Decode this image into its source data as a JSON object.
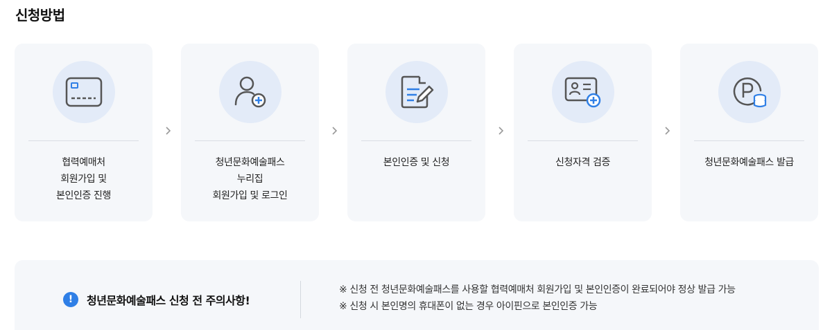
{
  "section_title": "신청방법",
  "steps": [
    {
      "icon": "credit-card-icon",
      "lines": [
        "협력예매처",
        "회원가입 및",
        "본인인증 진행"
      ]
    },
    {
      "icon": "user-add-icon",
      "lines": [
        "청년문화예술패스",
        "누리집",
        "회원가입 및 로그인"
      ]
    },
    {
      "icon": "document-edit-icon",
      "lines": [
        "본인인증 및 신청"
      ]
    },
    {
      "icon": "id-card-add-icon",
      "lines": [
        "신청자격 검증"
      ]
    },
    {
      "icon": "point-coin-icon",
      "lines": [
        "청년문화예술패스 발급"
      ]
    }
  ],
  "notice": {
    "icon_text": "!",
    "title": "청년문화예술패스 신청 전 주의사항!",
    "notes": [
      "※ 신청 전 청년문화예술패스를 사용할 협력예매처 회원가입 및 본인인증이 완료되어야 정상 발급 가능",
      "※ 신청 시 본인명의 휴대폰이 없는 경우 아이핀으로 본인인증 가능"
    ]
  },
  "colors": {
    "card_bg": "#f5f7fa",
    "icon_circle": "#e3ebf8",
    "icon_stroke": "#555555",
    "accent_blue": "#2f7fe6"
  }
}
